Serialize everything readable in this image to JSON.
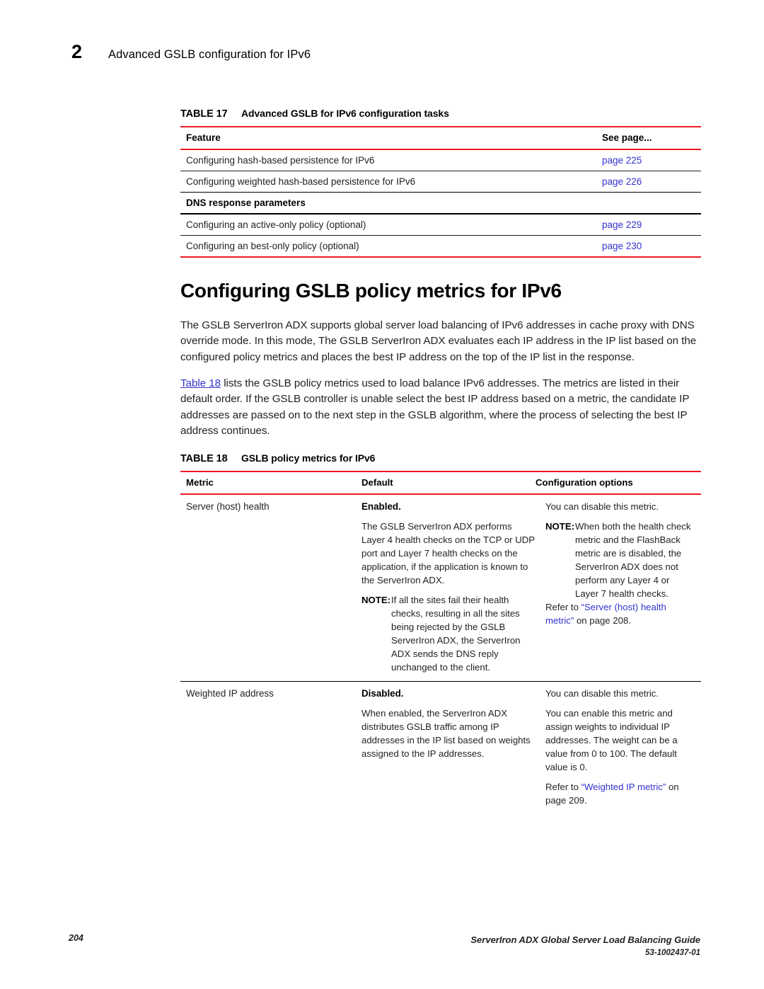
{
  "running_header": {
    "chapter_number": "2",
    "chapter_title": "Advanced GSLB configuration for IPv6"
  },
  "table17": {
    "label": "TABLE 17",
    "title": "Advanced GSLB for IPv6 configuration tasks",
    "headers": {
      "feature": "Feature",
      "see_page": "See page..."
    },
    "rows": [
      {
        "feature": "Configuring hash-based persistence for IPv6",
        "see_page": "page 225",
        "section": false
      },
      {
        "feature": "Configuring weighted hash-based persistence for IPv6",
        "see_page": "page 226",
        "section": false
      },
      {
        "feature": "DNS response parameters",
        "see_page": "",
        "section": true
      },
      {
        "feature": "Configuring an active-only policy (optional)",
        "see_page": "page 229",
        "section": false
      },
      {
        "feature": "Configuring an best-only policy (optional)",
        "see_page": "page 230",
        "section": false
      }
    ]
  },
  "section": {
    "title": "Configuring GSLB policy metrics for IPv6",
    "paragraph1": "The GSLB ServerIron ADX supports global server load balancing of IPv6 addresses in cache proxy with DNS override mode. In this mode, The GSLB ServerIron ADX evaluates each IP address in the IP list based on the configured policy metrics and places the best IP address on the top of the IP list in the response.",
    "paragraph2_link": "Table 18",
    "paragraph2_rest": " lists the GSLB policy metrics used to load balance IPv6 addresses. The metrics are listed in their default order. If the GSLB controller is unable select the best IP address based on a metric, the candidate IP addresses are passed on to the next step in the GSLB algorithm, where the process of selecting the best IP address continues."
  },
  "table18": {
    "label": "TABLE 18",
    "title": "GSLB policy metrics for IPv6",
    "headers": {
      "metric": "Metric",
      "default": "Default",
      "config_options": "Configuration options"
    },
    "rows": [
      {
        "metric": "Server (host) health",
        "default_bold": "Enabled.",
        "default_para": "The GSLB ServerIron ADX performs Layer 4 health checks on the TCP or UDP port and Layer 7 health checks on the application, if the application is known to the ServerIron ADX.",
        "default_note_label": "NOTE:",
        "default_note_body": "If all the sites fail their health checks, resulting in all the sites being rejected by the GSLB ServerIron ADX, the ServerIron ADX sends the DNS reply unchanged to the client.",
        "options_first": "You can disable this metric.",
        "options_note_label": "NOTE:",
        "options_note_body": "When both the health check metric and the FlashBack metric are is disabled, the ServerIron ADX does not perform any Layer 4 or Layer 7 health checks.",
        "options_refer_pre": "Refer to ",
        "options_refer_link": "“Server (host) health metric”",
        "options_refer_post": " on page 208."
      },
      {
        "metric": "Weighted IP address",
        "default_bold": "Disabled.",
        "default_para": "When enabled, the ServerIron ADX distributes GSLB traffic among IP addresses in the IP list based on weights assigned to the IP addresses.",
        "options_first": "You can disable this metric.",
        "options_second": "You can enable this metric and assign weights to individual IP addresses. The weight can be a value from 0 to 100. The default value is 0.",
        "options_refer_pre": "Refer to ",
        "options_refer_link": "“Weighted IP metric”",
        "options_refer_post": " on page 209."
      }
    ]
  },
  "footer": {
    "page_number": "204",
    "guide_title": "ServerIron ADX Global Server Load Balancing Guide",
    "doc_number": "53-1002437-01"
  },
  "colors": {
    "rule_red": "#ed1c24",
    "link_blue": "#3333cc",
    "text": "#231f20"
  }
}
